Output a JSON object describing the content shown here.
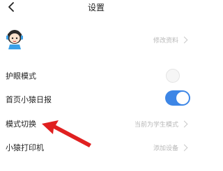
{
  "header": {
    "title": "设置"
  },
  "profile": {
    "action_label": "修改资料"
  },
  "settings": {
    "eye_care": {
      "label": "护眼模式",
      "enabled": false
    },
    "homepage_daily": {
      "label": "首页小猿日报",
      "enabled": true
    },
    "mode_switch": {
      "label": "模式切换",
      "value": "当前为学生模式"
    },
    "printer": {
      "label": "小猿打印机",
      "value": "添加设备"
    }
  },
  "colors": {
    "toggle_on": "#3d86e6",
    "arrow": "#e02020"
  }
}
